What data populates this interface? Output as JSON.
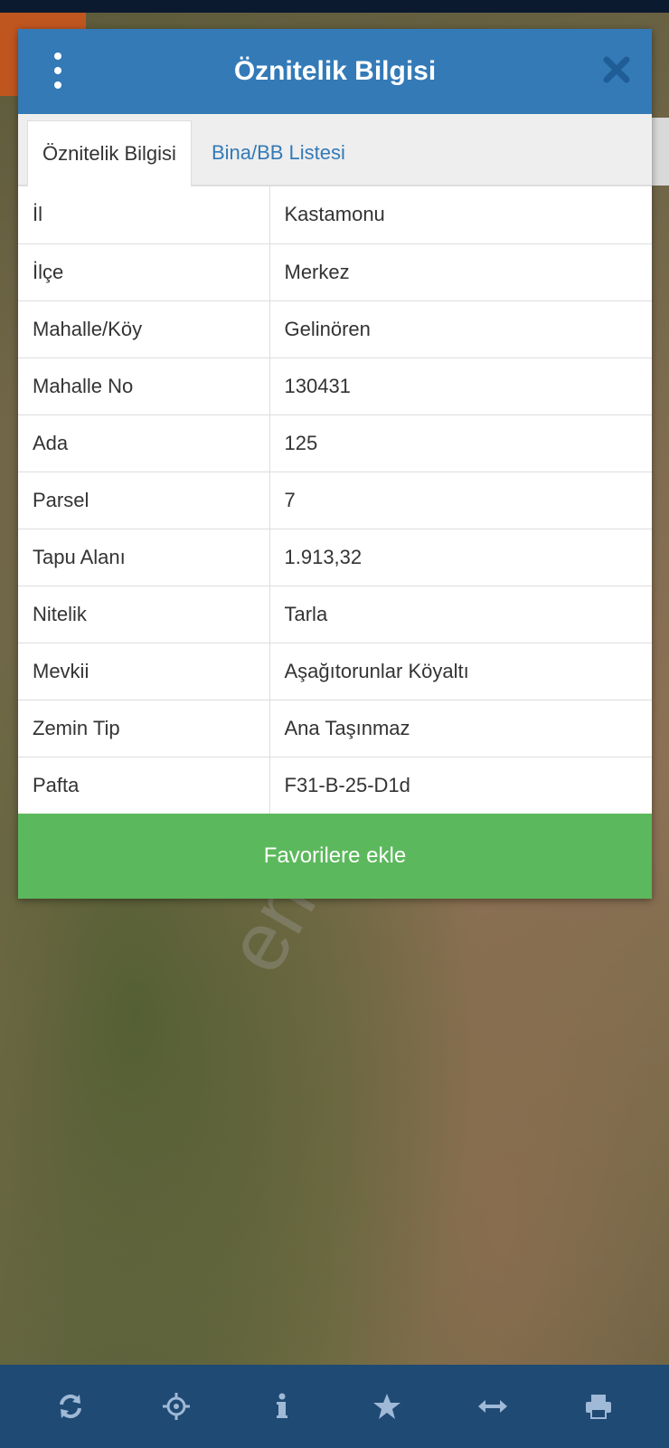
{
  "dialog": {
    "title": "Öznitelik Bilgisi",
    "tabs": [
      {
        "label": "Öznitelik Bilgisi",
        "active": true
      },
      {
        "label": "Bina/BB Listesi",
        "active": false
      }
    ],
    "rows": [
      {
        "label": "İl",
        "value": "Kastamonu"
      },
      {
        "label": "İlçe",
        "value": "Merkez"
      },
      {
        "label": "Mahalle/Köy",
        "value": "Gelinören"
      },
      {
        "label": "Mahalle No",
        "value": "130431"
      },
      {
        "label": "Ada",
        "value": "125"
      },
      {
        "label": "Parsel",
        "value": "7"
      },
      {
        "label": "Tapu Alanı",
        "value": "1.913,32"
      },
      {
        "label": "Nitelik",
        "value": "Tarla"
      },
      {
        "label": "Mevkii",
        "value": "Aşağıtorunlar Köyaltı"
      },
      {
        "label": "Zemin Tip",
        "value": "Ana Taşınmaz"
      },
      {
        "label": "Pafta",
        "value": "F31-B-25-D1d"
      }
    ],
    "favorite_button": "Favorilere ekle"
  },
  "watermark": "emlakjet.com",
  "bottom_bar": {
    "icons": [
      "refresh-icon",
      "locate-icon",
      "info-icon",
      "star-icon",
      "measure-icon",
      "print-icon"
    ]
  },
  "colors": {
    "header": "#337ab7",
    "favorite": "#5cb85c",
    "bottom_bar": "#1f4a74"
  }
}
